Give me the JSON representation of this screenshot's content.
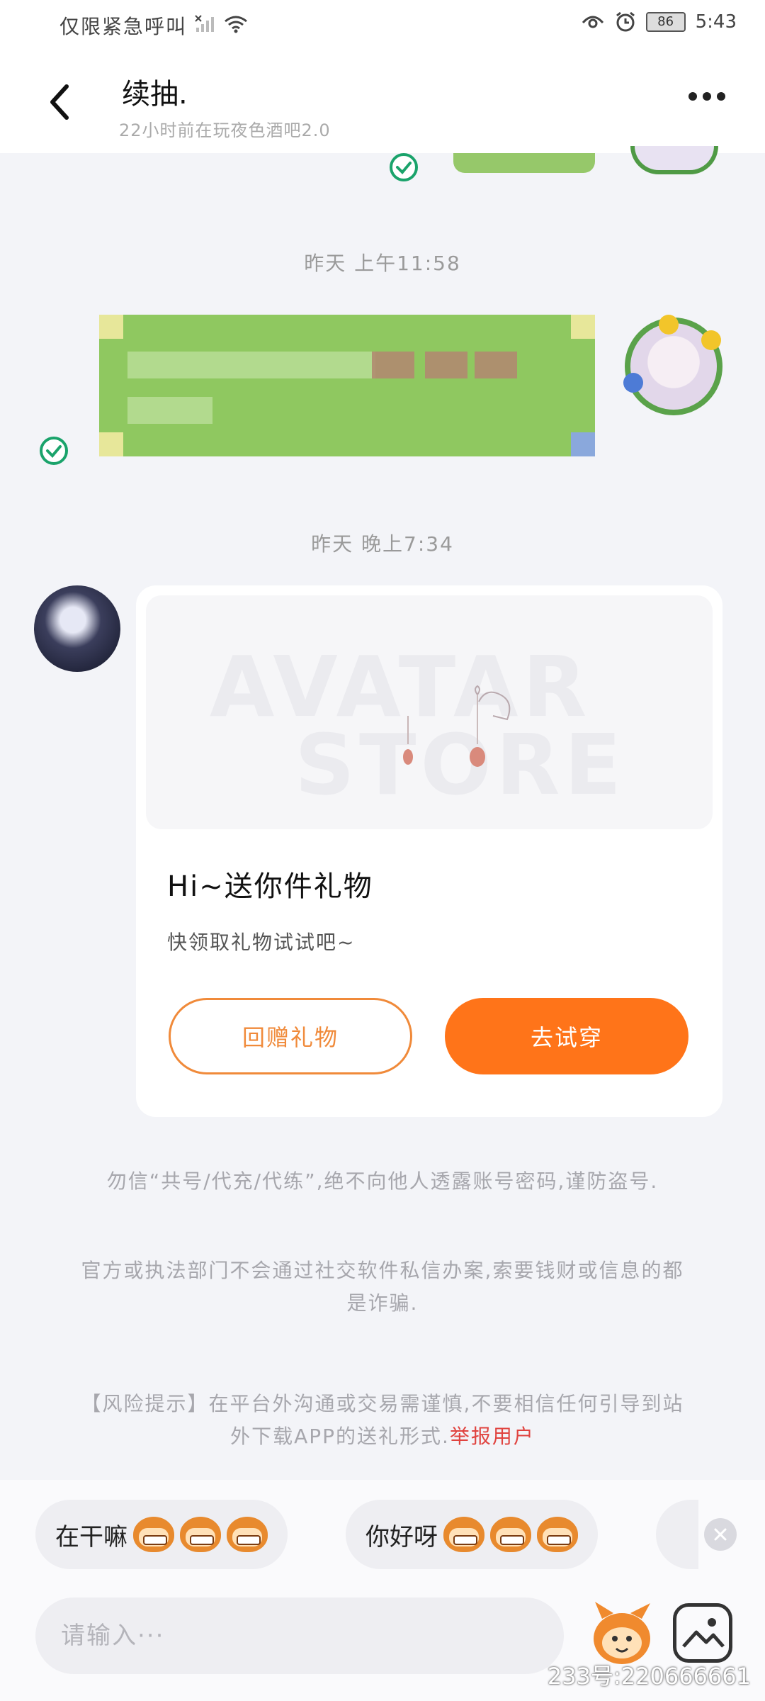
{
  "status_bar": {
    "carrier_text": "仅限紧急呼叫",
    "battery": "86",
    "time": "5:43"
  },
  "header": {
    "title": "续抽.",
    "subtitle": "22小时前在玩夜色酒吧2.0"
  },
  "messages": {
    "timestamp_1": "昨天 上午11:58",
    "timestamp_2": "昨天 晚上7:34"
  },
  "gift_card": {
    "image_watermark_line1": "AVATAR",
    "image_watermark_line2": "STORE",
    "title": "Hi~送你件礼物",
    "description": "快领取礼物试试吧~",
    "return_gift_label": "回赠礼物",
    "try_on_label": "去试穿"
  },
  "notices": {
    "line1": "勿信“共号/代充/代练”,绝不向他人透露账号密码,谨防盗号.",
    "line2": "官方或执法部门不会通过社交软件私信办案,索要钱财或信息的都是诈骗.",
    "line3_text": "【风险提示】在平台外沟通或交易需谨慎,不要相信任何引导到站外下载APP的送礼形式.",
    "report_link": "举报用户"
  },
  "quick_replies": [
    {
      "label": "在干嘛",
      "emoji": "grin-monkey-emoji"
    },
    {
      "label": "你好呀",
      "emoji": "smile-monkey-emoji"
    }
  ],
  "input": {
    "placeholder": "请输入···"
  },
  "watermark": {
    "id_text": "233号:220666661"
  },
  "colors": {
    "accent_orange": "#ff7419",
    "report_red": "#e0433f",
    "check_green": "#1aa36b"
  }
}
